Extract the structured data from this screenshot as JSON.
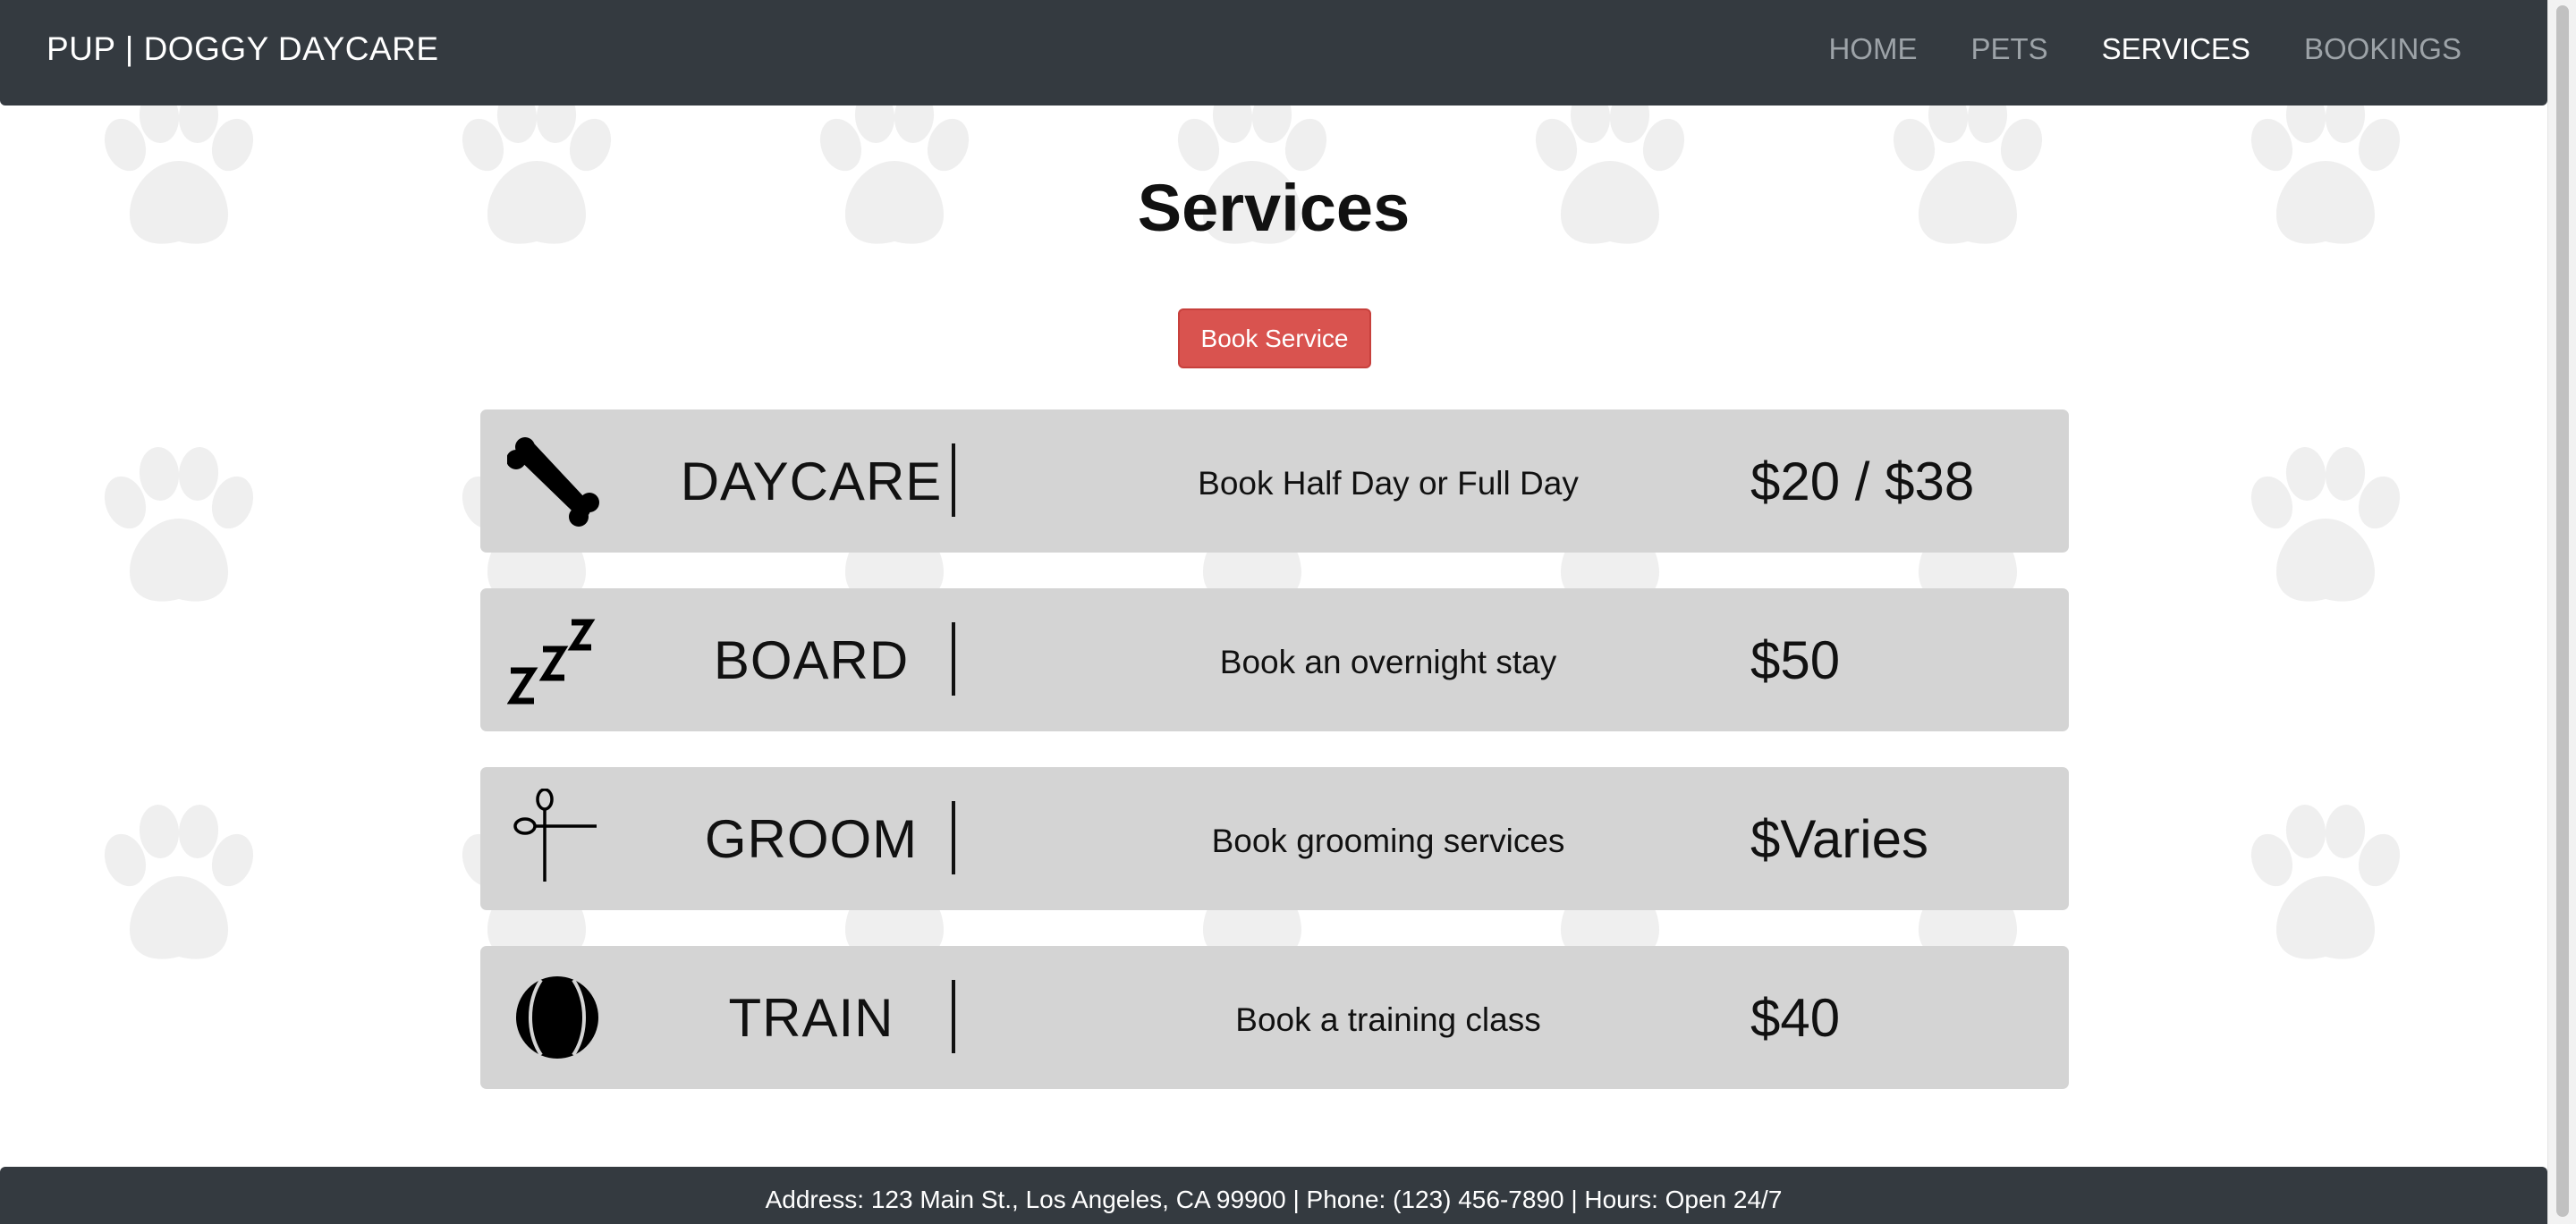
{
  "navbar": {
    "brand": "PUP | DOGGY DAYCARE",
    "links": [
      {
        "label": "HOME",
        "active": false
      },
      {
        "label": "PETS",
        "active": false
      },
      {
        "label": "SERVICES",
        "active": true
      },
      {
        "label": "BOOKINGS",
        "active": false
      }
    ]
  },
  "main": {
    "title": "Services",
    "book_button_label": "Book Service",
    "services": [
      {
        "icon": "bone-icon",
        "name": "DAYCARE",
        "description": "Book Half Day or Full Day",
        "price": "$20 / $38"
      },
      {
        "icon": "sleep-zzz-icon",
        "name": "BOARD",
        "description": "Book an overnight stay",
        "price": "$50"
      },
      {
        "icon": "scissors-icon",
        "name": "GROOM",
        "description": "Book grooming services",
        "price": "$Varies"
      },
      {
        "icon": "ball-icon",
        "name": "TRAIN",
        "description": "Book a training class",
        "price": "$40"
      }
    ]
  },
  "footer": {
    "text": "Address: 123 Main St., Los Angeles, CA 99900 | Phone: (123) 456-7890 | Hours: Open 24/7"
  },
  "colors": {
    "navbar_bg": "#343a40",
    "button_bg": "#d9534f",
    "card_bg": "#d4d4d4",
    "paw_color": "#efefef"
  }
}
